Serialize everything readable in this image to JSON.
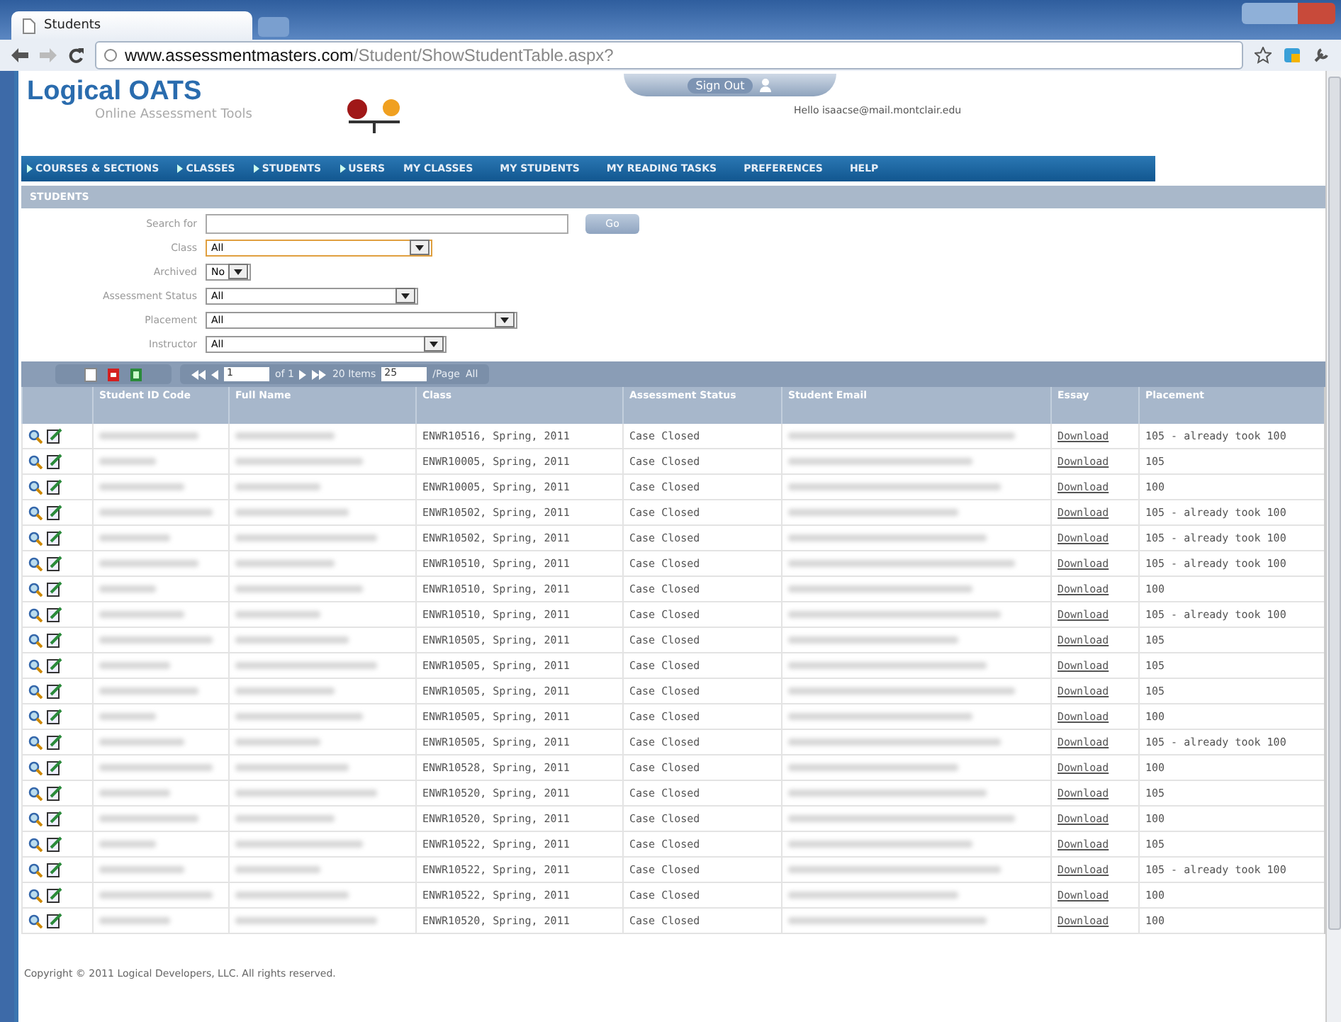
{
  "browser": {
    "tab_title": "Students",
    "url_host": "www.assessmentmasters.com",
    "url_path": "/Student/ShowStudentTable.aspx?"
  },
  "header": {
    "logo_title": "Logical OATS",
    "logo_subtitle": "Online Assessment Tools",
    "sign_out": "Sign Out",
    "greeting": "Hello isaacse@mail.montclair.edu"
  },
  "nav": [
    {
      "label": "COURSES & SECTIONS",
      "kind": "arrow"
    },
    {
      "label": "CLASSES",
      "kind": "arrow"
    },
    {
      "label": "STUDENTS",
      "kind": "arrow"
    },
    {
      "label": "USERS",
      "kind": "arrow"
    },
    {
      "label": "MY CLASSES",
      "kind": "plain"
    },
    {
      "label": "MY STUDENTS",
      "kind": "plain"
    },
    {
      "label": "MY READING TASKS",
      "kind": "plain"
    },
    {
      "label": "PREFERENCES",
      "kind": "plain"
    },
    {
      "label": "HELP",
      "kind": "plain"
    }
  ],
  "section_title": "STUDENTS",
  "filters": [
    {
      "label": "Search for",
      "kind": "text",
      "focused": false
    },
    {
      "label": "Class",
      "kind": "select",
      "value": "All",
      "focused": true
    },
    {
      "label": "Archived",
      "kind": "select",
      "value": "No",
      "focused": false
    },
    {
      "label": "Assessment Status",
      "kind": "select",
      "value": "All",
      "focused": false
    },
    {
      "label": "Placement",
      "kind": "select",
      "value": "All",
      "focused": false
    },
    {
      "label": "Instructor",
      "kind": "select",
      "value": "All",
      "focused": false
    }
  ],
  "go_button": "Go",
  "pager": {
    "page": "1",
    "of": "of 1",
    "items": "20 Items",
    "page_size": "25",
    "per_page": "/Page",
    "all": "All"
  },
  "table": {
    "columns": [
      "Student ID Code",
      "Full Name",
      "Class",
      "Assessment Status",
      "Student Email",
      "Essay",
      "Placement"
    ],
    "rows": [
      {
        "class": "ENWR10516, Spring, 2011",
        "status": "Case Closed",
        "essay": "Download",
        "placement": "105 - already took 100"
      },
      {
        "class": "ENWR10005, Spring, 2011",
        "status": "Case Closed",
        "essay": "Download",
        "placement": "105"
      },
      {
        "class": "ENWR10005, Spring, 2011",
        "status": "Case Closed",
        "essay": "Download",
        "placement": "100"
      },
      {
        "class": "ENWR10502, Spring, 2011",
        "status": "Case Closed",
        "essay": "Download",
        "placement": "105 - already took 100"
      },
      {
        "class": "ENWR10502, Spring, 2011",
        "status": "Case Closed",
        "essay": "Download",
        "placement": "105 - already took 100"
      },
      {
        "class": "ENWR10510, Spring, 2011",
        "status": "Case Closed",
        "essay": "Download",
        "placement": "105 - already took 100"
      },
      {
        "class": "ENWR10510, Spring, 2011",
        "status": "Case Closed",
        "essay": "Download",
        "placement": "100"
      },
      {
        "class": "ENWR10510, Spring, 2011",
        "status": "Case Closed",
        "essay": "Download",
        "placement": "105 - already took 100"
      },
      {
        "class": "ENWR10505, Spring, 2011",
        "status": "Case Closed",
        "essay": "Download",
        "placement": "105"
      },
      {
        "class": "ENWR10505, Spring, 2011",
        "status": "Case Closed",
        "essay": "Download",
        "placement": "105"
      },
      {
        "class": "ENWR10505, Spring, 2011",
        "status": "Case Closed",
        "essay": "Download",
        "placement": "105"
      },
      {
        "class": "ENWR10505, Spring, 2011",
        "status": "Case Closed",
        "essay": "Download",
        "placement": "100"
      },
      {
        "class": "ENWR10505, Spring, 2011",
        "status": "Case Closed",
        "essay": "Download",
        "placement": "105 - already took 100"
      },
      {
        "class": "ENWR10528, Spring, 2011",
        "status": "Case Closed",
        "essay": "Download",
        "placement": "100"
      },
      {
        "class": "ENWR10520, Spring, 2011",
        "status": "Case Closed",
        "essay": "Download",
        "placement": "105"
      },
      {
        "class": "ENWR10520, Spring, 2011",
        "status": "Case Closed",
        "essay": "Download",
        "placement": "100"
      },
      {
        "class": "ENWR10522, Spring, 2011",
        "status": "Case Closed",
        "essay": "Download",
        "placement": "105"
      },
      {
        "class": "ENWR10522, Spring, 2011",
        "status": "Case Closed",
        "essay": "Download",
        "placement": "105 - already took 100"
      },
      {
        "class": "ENWR10522, Spring, 2011",
        "status": "Case Closed",
        "essay": "Download",
        "placement": "100"
      },
      {
        "class": "ENWR10520, Spring, 2011",
        "status": "Case Closed",
        "essay": "Download",
        "placement": "100"
      }
    ]
  },
  "footer": "Copyright © 2011 Logical Developers, LLC. All rights reserved."
}
